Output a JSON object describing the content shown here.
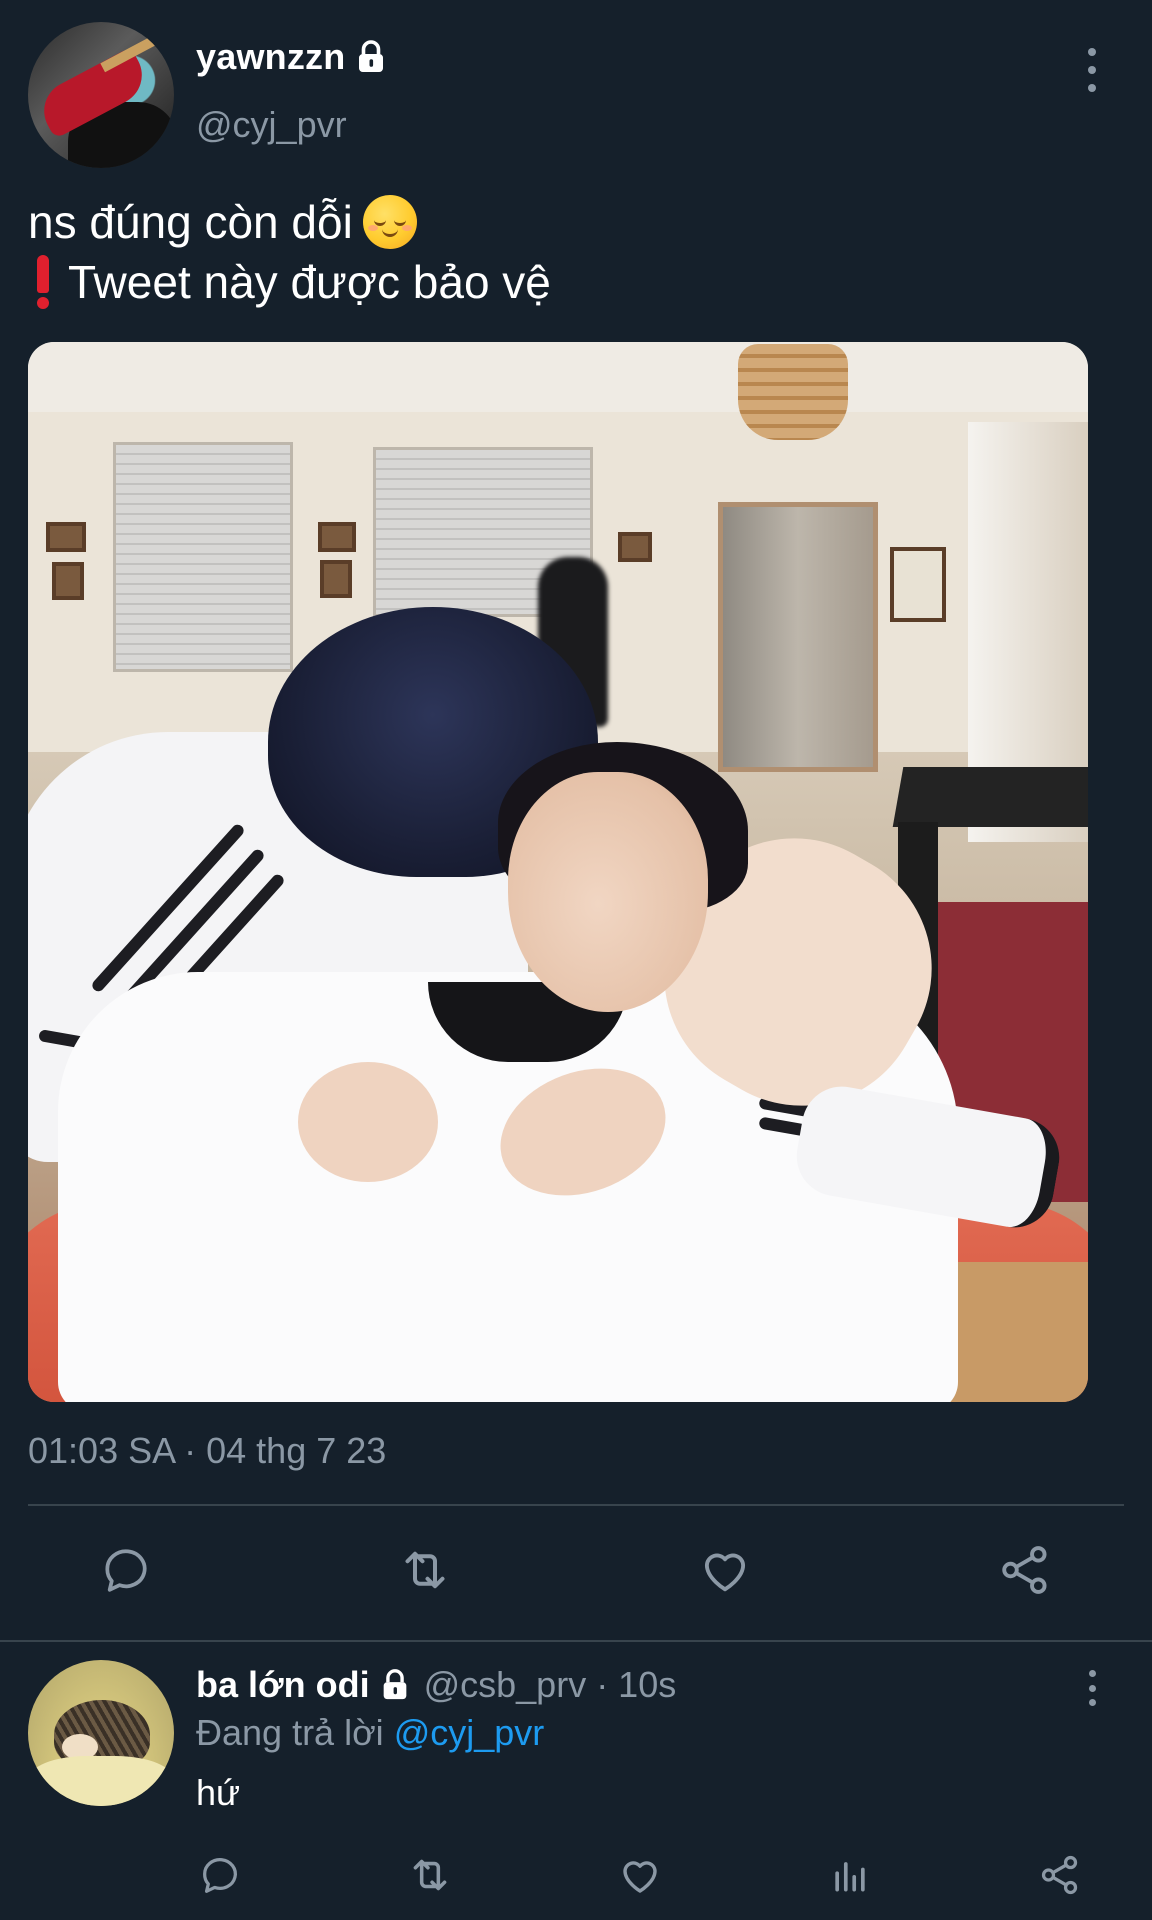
{
  "tweet": {
    "display_name": "yawnzzn",
    "handle": "@cyj_pvr",
    "text_line1": "ns đúng còn dỗi",
    "text_line2": "Tweet này được bảo vệ",
    "timestamp": "01:03 SA · 04 thg 7 23",
    "icons": [
      "lock-icon",
      "more-icon",
      "relieved-face-emoji",
      "exclamation-icon"
    ],
    "actions": [
      "reply-icon",
      "retweet-icon",
      "like-icon",
      "share-icon"
    ]
  },
  "reply": {
    "display_name": "ba lớn odi",
    "handle_time": "@csb_prv · 10s",
    "replying_prefix": "Đang trả lời",
    "replying_to": "@cyj_pvr",
    "text": "hứ",
    "actions": [
      "reply-icon",
      "retweet-icon",
      "like-icon",
      "analytics-icon",
      "share-icon"
    ]
  },
  "colors": {
    "background": "#15202b",
    "secondary_text": "#8b98a5",
    "link": "#1d9bf0",
    "divider": "#38444d"
  }
}
